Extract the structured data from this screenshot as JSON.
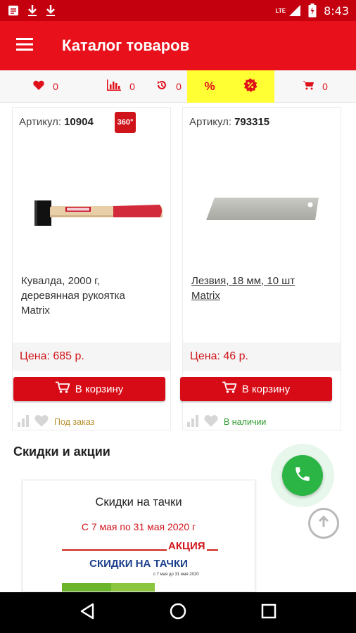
{
  "status_bar": {
    "time": "8:43",
    "network": "LTE"
  },
  "toolbar": {
    "title": "Каталог товаров"
  },
  "action_strip": {
    "favorites_count": "0",
    "compare_count": "0",
    "history_count": "0",
    "percent_label": "%",
    "cart_count": "0"
  },
  "products": [
    {
      "sku_label": "Артикул:",
      "sku": "10904",
      "badge": "360°",
      "name": "Кувалда, 2000 г,\nдеревянная рукоятка\nMatrix",
      "price": "Цена: 685 р.",
      "cart_label": "В корзину",
      "availability": "Под заказ"
    },
    {
      "sku_label": "Артикул:",
      "sku": "793315",
      "name": "Лезвия, 18 мм, 10 шт\nMatrix",
      "price": "Цена: 46 р.",
      "cart_label": "В корзину",
      "availability": "В наличии"
    }
  ],
  "section": {
    "title": "Скидки и акции"
  },
  "promo": {
    "title": "Скидки на тачки",
    "dates": "С 7 мая по 31 мая 2020 г",
    "banner_tag": "АКЦИЯ",
    "banner_text": "СКИДКИ НА ТАЧКИ",
    "banner_small": "с 7 мая до 31 мая 2020"
  },
  "colors": {
    "brand_red": "#e8101a",
    "status_red": "#c4000f",
    "highlight_yellow": "#ffff33",
    "call_green": "#2bb545"
  },
  "icons": [
    "menu-icon",
    "heart-icon",
    "compare-chart-icon",
    "history-icon",
    "percent-icon",
    "discount-badge-icon",
    "cart-icon",
    "phone-icon",
    "arrow-up-icon",
    "back-icon",
    "home-icon",
    "recents-icon"
  ]
}
